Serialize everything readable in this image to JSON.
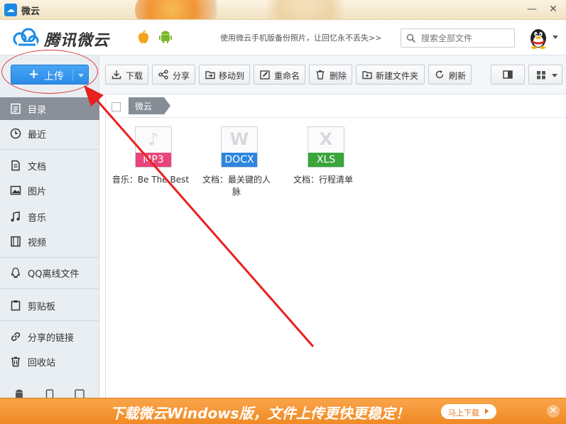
{
  "window": {
    "title": "微云",
    "minimize": "—",
    "close": "✕"
  },
  "header": {
    "brand": "腾讯微云",
    "promo": "使用微云手机版备份照片，让回忆永不丢失>>",
    "search_placeholder": "搜索全部文件"
  },
  "sidebar": {
    "upload_label": "上传",
    "items": [
      {
        "label": "目录",
        "icon": "folder-tree-icon",
        "active": true
      },
      {
        "label": "最近",
        "icon": "clock-icon"
      },
      {
        "label": "文档",
        "icon": "document-icon"
      },
      {
        "label": "图片",
        "icon": "image-icon"
      },
      {
        "label": "音乐",
        "icon": "music-icon"
      },
      {
        "label": "视频",
        "icon": "video-icon"
      },
      {
        "label": "QQ离线文件",
        "icon": "qq-icon"
      },
      {
        "label": "剪贴板",
        "icon": "clipboard-icon"
      },
      {
        "label": "分享的链接",
        "icon": "link-icon"
      },
      {
        "label": "回收站",
        "icon": "trash-icon"
      }
    ]
  },
  "toolbar": {
    "download": "下载",
    "share": "分享",
    "move": "移动到",
    "rename": "重命名",
    "delete": "删除",
    "new_folder": "新建文件夹",
    "refresh": "刷新"
  },
  "breadcrumb": {
    "current": "微云"
  },
  "files": [
    {
      "type_label": "MP3",
      "big_letter": "♪",
      "color": "#e8457a",
      "name": "音乐：Be The Best"
    },
    {
      "type_label": "DOCX",
      "big_letter": "W",
      "color": "#2e86de",
      "name": "文档：最关键的人脉"
    },
    {
      "type_label": "XLS",
      "big_letter": "X",
      "color": "#39a53a",
      "name": "文档：行程清单"
    }
  ],
  "banner": {
    "text": "下载微云Windows版，文件上传更快更稳定！",
    "button": "马上下载"
  },
  "colors": {
    "accent": "#2b8ae6",
    "annotation": "#e8201e",
    "banner": "#f08a24"
  }
}
